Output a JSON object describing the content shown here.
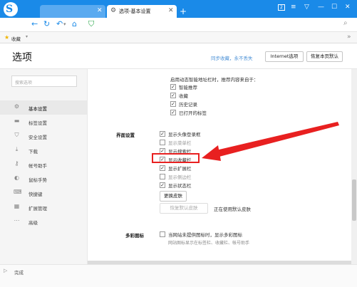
{
  "browser": {
    "tabs": [
      {
        "title": ""
      },
      {
        "title": "选项-基本设置"
      }
    ],
    "window_badge": "2"
  },
  "bookmarks": {
    "label": "收藏"
  },
  "header": {
    "title": "选项",
    "sync_text": "同步收藏，永不丢失",
    "internet_options": "Internet选项",
    "restore_default": "恢复本页默认"
  },
  "sidebar": {
    "search_placeholder": "搜索选项",
    "items": [
      {
        "label": "基本设置",
        "icon": "gear-icon",
        "active": true
      },
      {
        "label": "标签设置",
        "icon": "tab-icon",
        "active": false
      },
      {
        "label": "安全设置",
        "icon": "shield-icon",
        "active": false
      },
      {
        "label": "下载",
        "icon": "download-icon",
        "active": false
      },
      {
        "label": "帐号助手",
        "icon": "key-icon",
        "active": false
      },
      {
        "label": "鼠标手势",
        "icon": "mouse-icon",
        "active": false
      },
      {
        "label": "快捷键",
        "icon": "keyboard-icon",
        "active": false
      },
      {
        "label": "扩展管理",
        "icon": "extension-icon",
        "active": false
      },
      {
        "label": "高级",
        "icon": "more-icon",
        "active": false
      }
    ]
  },
  "address_suggest": {
    "intro": "启用动态智能地址栏时，推荐内容来自于：",
    "options": [
      {
        "label": "智能推荐",
        "checked": true
      },
      {
        "label": "收藏",
        "checked": true
      },
      {
        "label": "历史记录",
        "checked": true
      },
      {
        "label": "已打开的标签",
        "checked": true
      }
    ]
  },
  "interface": {
    "section_label": "界面设置",
    "options": [
      {
        "label": "显示头像登录框",
        "checked": true
      },
      {
        "label": "显示菜单栏",
        "checked": false
      },
      {
        "label": "显示搜索栏",
        "checked": true
      },
      {
        "label": "显示收藏栏",
        "checked": true
      },
      {
        "label": "显示扩展栏",
        "checked": true
      },
      {
        "label": "显示侧边栏",
        "checked": false
      },
      {
        "label": "显示状态栏",
        "checked": true
      }
    ],
    "change_skin": "更换皮肤",
    "restore_skin": "恢复默认皮肤",
    "using_default": "正在使用默认皮肤"
  },
  "color_icon": {
    "section_label": "多彩图标",
    "option": {
      "label": "当网站未提供图标时，显示多彩图标",
      "checked": false
    },
    "hint": "网站图标显示在标签栏、收藏栏、帐号助手"
  },
  "status": {
    "text": "完成"
  },
  "colors": {
    "accent": "#1a8ae8",
    "annotation": "#e82020"
  }
}
